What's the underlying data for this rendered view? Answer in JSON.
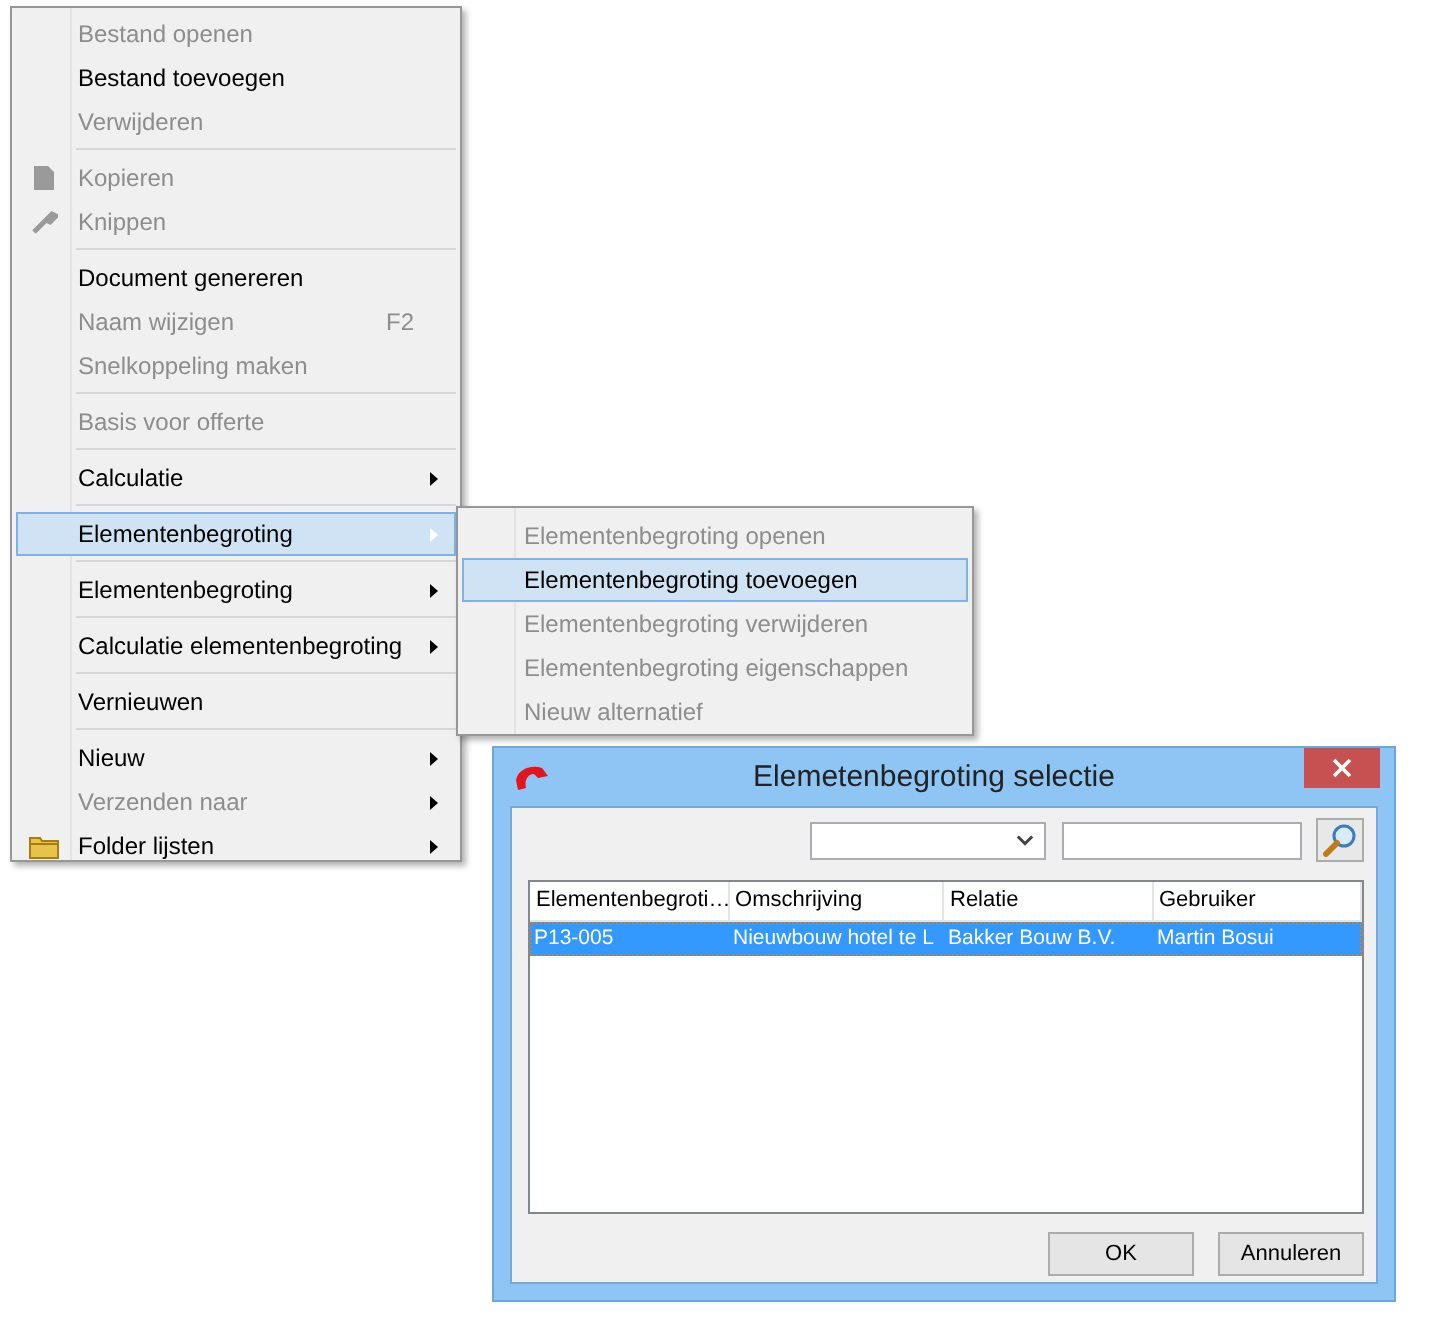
{
  "context_menu": {
    "groups": [
      [
        {
          "label": "Bestand openen",
          "disabled": true,
          "submenu": false,
          "selected": false,
          "kind": "text"
        },
        {
          "label": "Bestand toevoegen",
          "disabled": false,
          "submenu": false,
          "selected": false,
          "kind": "text"
        },
        {
          "label": "Verwijderen",
          "disabled": true,
          "submenu": false,
          "selected": false,
          "kind": "text"
        }
      ],
      [
        {
          "label": "Kopieren",
          "disabled": true,
          "submenu": false,
          "selected": false,
          "kind": "copy"
        },
        {
          "label": "Knippen",
          "disabled": true,
          "submenu": false,
          "selected": false,
          "kind": "cut"
        }
      ],
      [
        {
          "label": "Document genereren",
          "disabled": false,
          "submenu": false,
          "selected": false,
          "kind": "text"
        },
        {
          "label": "Naam wijzigen",
          "shortcut": "F2",
          "disabled": true,
          "submenu": false,
          "selected": false,
          "kind": "text"
        },
        {
          "label": "Snelkoppeling maken",
          "disabled": true,
          "submenu": false,
          "selected": false,
          "kind": "text"
        }
      ],
      [
        {
          "label": "Basis voor offerte",
          "disabled": true,
          "submenu": false,
          "selected": false,
          "kind": "text"
        }
      ],
      [
        {
          "label": "Calculatie",
          "disabled": false,
          "submenu": true,
          "selected": false,
          "kind": "text"
        }
      ],
      [
        {
          "label": "Elementenbegroting",
          "disabled": false,
          "submenu": true,
          "selected": true,
          "kind": "text"
        }
      ],
      [
        {
          "label": "Elementenbegroting",
          "disabled": false,
          "submenu": true,
          "selected": false,
          "kind": "text"
        }
      ],
      [
        {
          "label": "Calculatie elementenbegroting",
          "disabled": false,
          "submenu": true,
          "selected": false,
          "kind": "text"
        }
      ],
      [
        {
          "label": "Vernieuwen",
          "disabled": false,
          "submenu": false,
          "selected": false,
          "kind": "text"
        }
      ],
      [
        {
          "label": "Nieuw",
          "disabled": false,
          "submenu": true,
          "selected": false,
          "kind": "text"
        },
        {
          "label": "Verzenden naar",
          "disabled": true,
          "submenu": true,
          "selected": false,
          "kind": "text"
        },
        {
          "label": "Folder lijsten",
          "disabled": false,
          "submenu": true,
          "selected": false,
          "kind": "folder"
        }
      ]
    ]
  },
  "submenu": {
    "items": [
      {
        "label": "Elementenbegroting openen",
        "disabled": true,
        "selected": false
      },
      {
        "label": "Elementenbegroting toevoegen",
        "disabled": false,
        "selected": true
      },
      {
        "label": "Elementenbegroting verwijderen",
        "disabled": true,
        "selected": false
      },
      {
        "label": "Elementenbegroting eigenschappen",
        "disabled": true,
        "selected": false
      },
      {
        "label": "Nieuw alternatief",
        "disabled": true,
        "selected": false
      }
    ]
  },
  "dialog": {
    "title": "Elemetenbegroting selectie",
    "table": {
      "columns": [
        "Elementenbegroti…",
        "Omschrijving",
        "Relatie",
        "Gebruiker"
      ],
      "rows": [
        {
          "cells": [
            "P13-005",
            "Nieuwbouw hotel te L",
            "Bakker Bouw B.V.",
            "Martin Bosui"
          ],
          "selected": true
        }
      ]
    },
    "buttons": [
      "OK",
      "Annuleren"
    ]
  }
}
